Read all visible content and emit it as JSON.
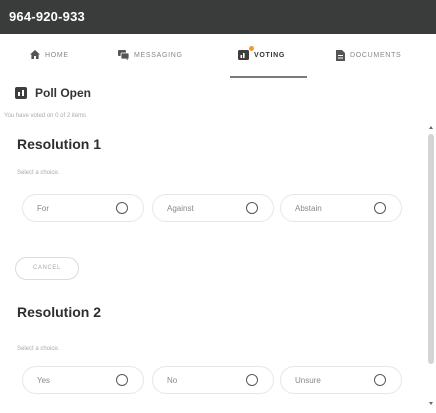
{
  "app": {
    "title": "964-920-933"
  },
  "tabs": [
    {
      "label": "HOME",
      "icon": "home-icon",
      "active": false
    },
    {
      "label": "MESSAGING",
      "icon": "messaging-icon",
      "active": false
    },
    {
      "label": "VOTING",
      "icon": "voting-icon",
      "active": true
    },
    {
      "label": "DOCUMENTS",
      "icon": "documents-icon",
      "active": false
    }
  ],
  "poll": {
    "status": "Poll Open",
    "progress_note": "You have voted on 0 of 2 items"
  },
  "resolutions": [
    {
      "title": "Resolution 1",
      "hint": "Select a choice.",
      "choices": [
        "For",
        "Against",
        "Abstain"
      ],
      "cancel_label": "CANCEL"
    },
    {
      "title": "Resolution 2",
      "hint": "Select a choice.",
      "choices": [
        "Yes",
        "No",
        "Unsure"
      ]
    }
  ],
  "colors": {
    "topbar": "#3a3b3b",
    "notification_dot": "#f29a2e"
  }
}
